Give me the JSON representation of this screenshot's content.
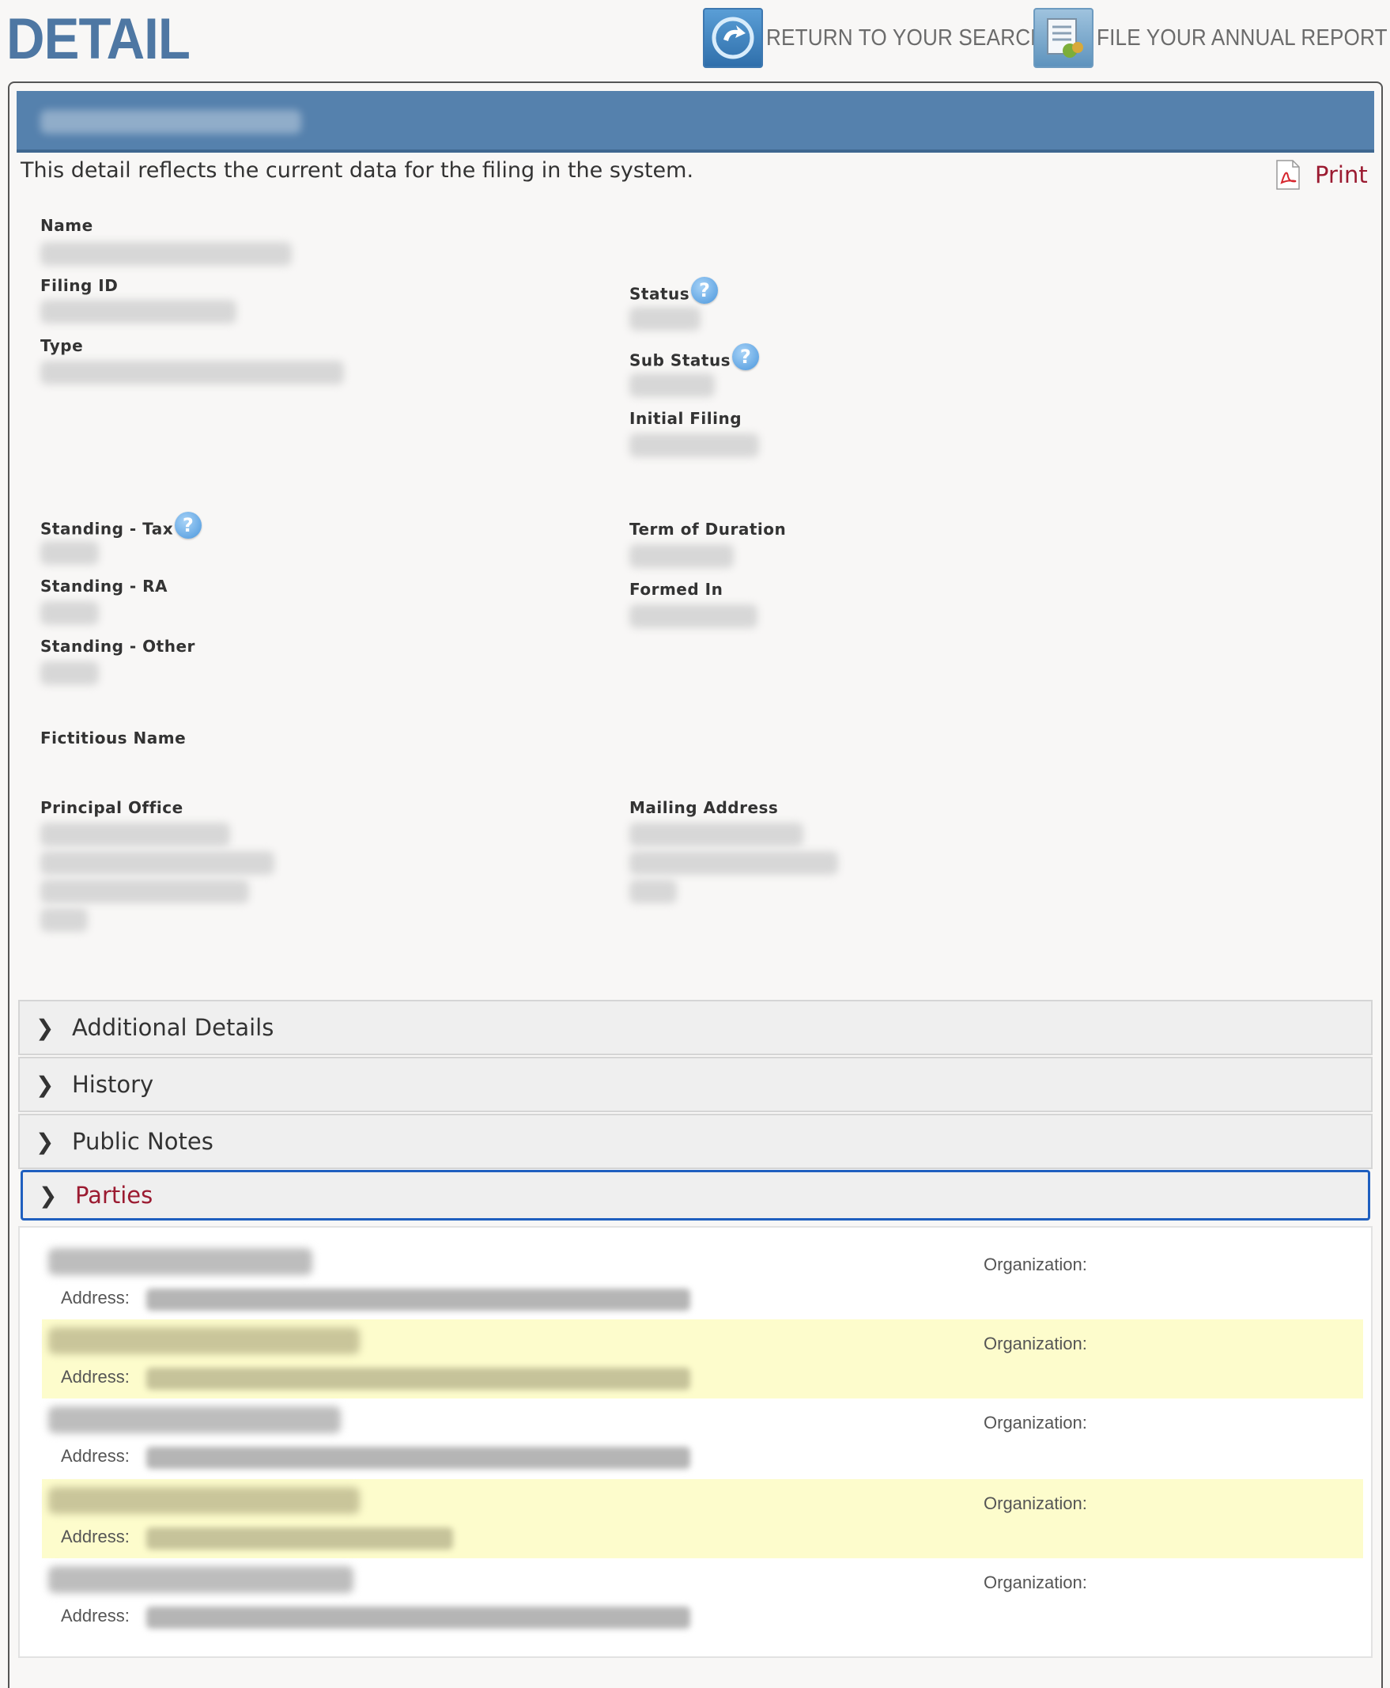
{
  "header": {
    "title": "DETAIL",
    "return_label": "RETURN TO YOUR SEARCH",
    "annual_label": "FILE YOUR ANNUAL REPORT"
  },
  "detail_note": "This detail reflects the current data for the filing in the system.",
  "print_label": "Print",
  "labels": {
    "name": "Name",
    "filing_id": "Filing ID",
    "type": "Type",
    "status": "Status",
    "sub_status": "Sub Status",
    "initial_filing": "Initial Filing",
    "standing_tax": "Standing - Tax",
    "standing_ra": "Standing - RA",
    "standing_other": "Standing - Other",
    "term_of_duration": "Term of Duration",
    "formed_in": "Formed In",
    "fictitious_name": "Fictitious Name",
    "principal_office": "Principal Office",
    "mailing_address": "Mailing Address"
  },
  "help_glyph": "?",
  "accordion": {
    "additional_details": "Additional Details",
    "history": "History",
    "public_notes": "Public Notes",
    "parties": "Parties"
  },
  "parties": {
    "address_label": "Address:",
    "organization_label": "Organization:"
  },
  "colors": {
    "title_blue": "#4e77a3",
    "name_bar": "#5581ad",
    "accent_red": "#9b1b31",
    "highlight_row": "#fdfccc",
    "focus_border": "#1f5fbf"
  },
  "icons": [
    "return-search-icon",
    "annual-report-icon",
    "pdf-icon",
    "help-icon",
    "chevron-right-icon"
  ]
}
